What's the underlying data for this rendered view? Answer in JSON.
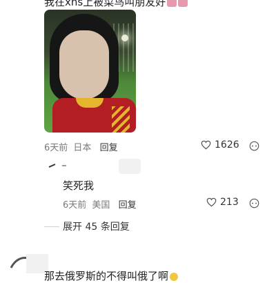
{
  "comment": {
    "text": "我在xhs上被菜鸟叫朋友好",
    "meta": {
      "time": "6天前",
      "location": "日本",
      "reply_label": "回复"
    },
    "likes": "1626"
  },
  "reply": {
    "text": "笑死我",
    "meta": {
      "time": "6天前",
      "location": "美国",
      "reply_label": "回复"
    },
    "likes": "213"
  },
  "expand_label": "展开 45 条回复",
  "next_comment": {
    "text": "那去俄罗斯的不得叫俄了啊"
  },
  "icons": {
    "heart": "heart-outline-icon",
    "more": "more-circle-icon"
  },
  "colors": {
    "text": "#222222",
    "meta": "#7a7a7a",
    "icon": "#555555"
  }
}
